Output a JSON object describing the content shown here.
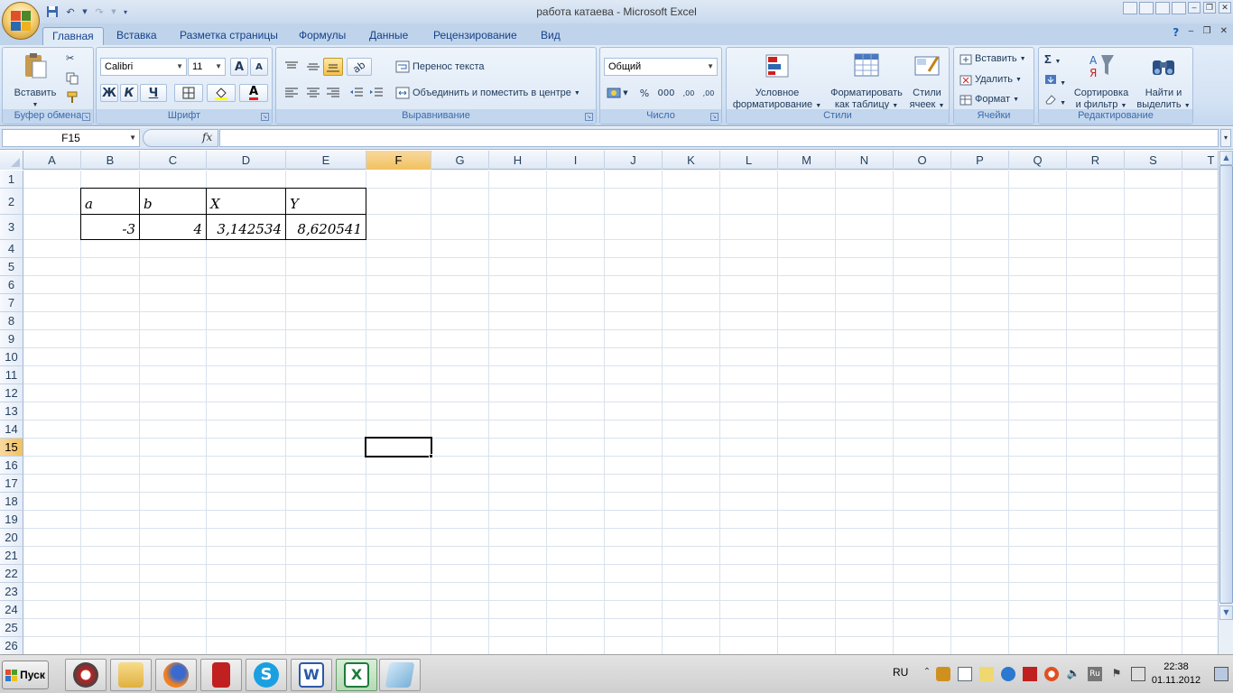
{
  "window": {
    "title": "работа катаева - Microsoft Excel",
    "controls": {
      "minimize": "‒",
      "restore": "❐",
      "close": "✕"
    }
  },
  "tabs": [
    "Главная",
    "Вставка",
    "Разметка страницы",
    "Формулы",
    "Данные",
    "Рецензирование",
    "Вид"
  ],
  "ribbon": {
    "clipboard": {
      "label": "Буфер обмена",
      "paste": "Вставить"
    },
    "font": {
      "label": "Шрифт",
      "font_name": "Calibri",
      "font_size": "11",
      "bold": "Ж",
      "italic": "К",
      "underline": "Ч",
      "grow": "A",
      "shrink": "A",
      "font_color": "A"
    },
    "alignment": {
      "label": "Выравнивание",
      "wrap": "Перенос текста",
      "merge": "Объединить и поместить в центре"
    },
    "number": {
      "label": "Число",
      "format": "Общий",
      "percent": "%",
      "thousands": "000",
      "inc_decimal": ",00",
      "dec_decimal": ",00"
    },
    "styles": {
      "label": "Стили",
      "conditional_1": "Условное",
      "conditional_2": "форматирование",
      "table_1": "Форматировать",
      "table_2": "как таблицу",
      "cell_1": "Стили",
      "cell_2": "ячеек"
    },
    "cells": {
      "label": "Ячейки",
      "insert": "Вставить",
      "delete": "Удалить",
      "format": "Формат"
    },
    "editing": {
      "label": "Редактирование",
      "sum": "Σ",
      "sort_1": "Сортировка",
      "sort_2": "и фильтр",
      "find_1": "Найти и",
      "find_2": "выделить"
    }
  },
  "formula_bar": {
    "name_box": "F15",
    "fx": "fx",
    "formula": ""
  },
  "sheet": {
    "columns": [
      "A",
      "B",
      "C",
      "D",
      "E",
      "F",
      "G",
      "H",
      "I",
      "J",
      "K",
      "L",
      "M",
      "N",
      "O",
      "P",
      "Q",
      "R",
      "S",
      "T"
    ],
    "rows": [
      "1",
      "2",
      "3",
      "4",
      "5",
      "6",
      "7",
      "8",
      "9",
      "10",
      "11",
      "12",
      "13",
      "14",
      "15",
      "16",
      "17",
      "18",
      "19",
      "20",
      "21",
      "22",
      "23",
      "24",
      "25",
      "26"
    ],
    "selected_cell": "F15",
    "cells": {
      "B2": "a",
      "C2": "b",
      "D2": "X",
      "E2": "Y",
      "B3": "-3",
      "C3": "4",
      "D3": "3,142534",
      "E3": "8,620541"
    }
  },
  "taskbar": {
    "start": "Пуск",
    "lang": "RU",
    "time": "22:38",
    "date": "01.11.2012"
  },
  "colors": {
    "ribbon_bg": "#d3e2f4",
    "selection_header": "#f1c15f",
    "excel_green": "#1d7b3a"
  }
}
